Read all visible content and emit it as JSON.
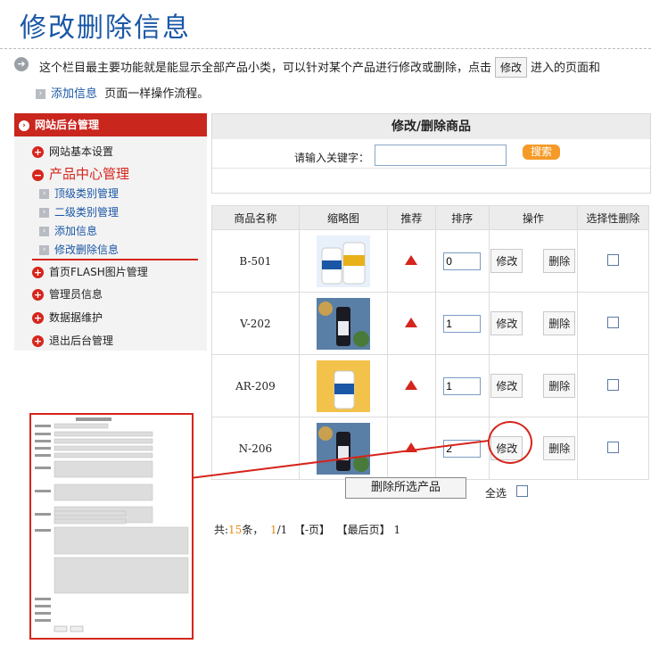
{
  "page": {
    "title": "修改删除信息",
    "intro_before": "这个栏目最主要功能就是能显示全部产品小类，可以针对某个产品进行修改或删除，点击",
    "intro_button": "修改",
    "intro_after": "进入的页面和",
    "intro2_link": "添加信息",
    "intro2_text": "页面一样操作流程。"
  },
  "sidebar": {
    "header": "网站后台管理",
    "items": [
      {
        "label": "网站基本设置",
        "icon": "plus-circle-icon"
      },
      {
        "label": "产品中心管理",
        "icon": "minus-circle-icon"
      },
      {
        "label": "首页FLASH图片管理",
        "icon": "plus-circle-icon"
      },
      {
        "label": "管理员信息",
        "icon": "plus-circle-icon"
      },
      {
        "label": "数据据维护",
        "icon": "plus-circle-icon"
      },
      {
        "label": "退出后台管理",
        "icon": "plus-circle-icon"
      }
    ],
    "sub_items": [
      "顶级类别管理",
      "二级类别管理",
      "添加信息",
      "修改删除信息"
    ]
  },
  "search": {
    "title": "修改/删除商品",
    "label": "请输入关键字：",
    "value": "",
    "button": "搜索"
  },
  "table": {
    "headers": [
      "商品名称",
      "缩略图",
      "推荐",
      "排序",
      "操作",
      "选择性删除"
    ],
    "edit_label": "修改",
    "delete_label": "删除",
    "rows": [
      {
        "name": "B-501",
        "order": "0"
      },
      {
        "name": "V-202",
        "order": "1"
      },
      {
        "name": "AR-209",
        "order": "1"
      },
      {
        "name": "N-206",
        "order": "2"
      }
    ]
  },
  "actions": {
    "bulk_delete": "删除所选产品",
    "select_all": "全选"
  },
  "pager": {
    "prefix": "共:",
    "total": "15",
    "suffix": "条，",
    "current": "1",
    "pages": "/1",
    "prev": "【-页】",
    "last": "【最后页】",
    "page_no": "1"
  },
  "colors": {
    "accent_red": "#d5251c",
    "title_blue": "#1a57a6",
    "search_orange": "#f59a28"
  }
}
